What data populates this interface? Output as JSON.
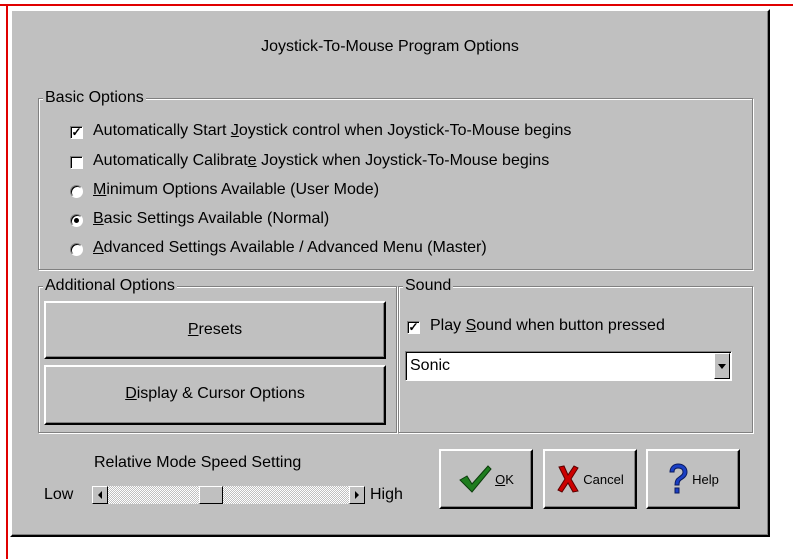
{
  "dialog": {
    "title": "Joystick-To-Mouse Program Options"
  },
  "basic_options": {
    "legend": "Basic Options",
    "auto_start": {
      "pre": "Automatically Start ",
      "ul": "J",
      "post": "oystick control when Joystick-To-Mouse begins",
      "checked": true
    },
    "auto_calibrate": {
      "pre": "Automatically Calibrat",
      "ul": "e",
      "post": " Joystick when Joystick-To-Mouse begins",
      "checked": false
    },
    "mode_options": [
      {
        "ul": "M",
        "post": "inimum Options Available (User Mode)",
        "selected": false
      },
      {
        "ul": "B",
        "post": "asic Settings Available (Normal)",
        "selected": true
      },
      {
        "ul": "A",
        "post": "dvanced Settings Available / Advanced Menu (Master)",
        "selected": false
      }
    ]
  },
  "additional_options": {
    "legend": "Additional Options",
    "presets": {
      "ul": "P",
      "post": "resets"
    },
    "display_cursor": {
      "ul": "D",
      "post": "isplay & Cursor Options"
    }
  },
  "sound": {
    "legend": "Sound",
    "play_sound": {
      "pre": "Play ",
      "ul": "S",
      "post": "ound when button pressed",
      "checked": true
    },
    "selected_sound": "Sonic"
  },
  "speed": {
    "label": "Relative Mode Speed Setting",
    "low": "Low",
    "high": "High",
    "value_fraction": 0.42
  },
  "buttons": {
    "ok": {
      "ul": "O",
      "post": "K"
    },
    "cancel": "Cancel",
    "help": "Help"
  },
  "icons": {
    "ok": "checkmark-icon",
    "cancel": "x-mark-icon",
    "help": "question-mark-icon",
    "combo": "chevron-down-icon"
  },
  "colors": {
    "face": "#c0c0c0",
    "ok_check": "#1e7d1e",
    "cancel_x": "#cc0000",
    "help_q": "#1a3fc4",
    "frame_red": "#e00000"
  }
}
